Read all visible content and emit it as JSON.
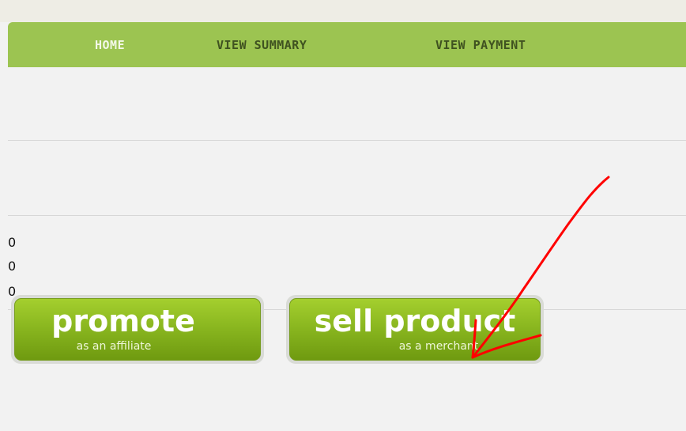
{
  "nav": {
    "home": "HOME",
    "summary": "VIEW SUMMARY",
    "payment": "VIEW PAYMENT"
  },
  "values": [
    "0",
    "0",
    "0"
  ],
  "buttons": {
    "promote": {
      "main": "promote",
      "sub": "as an affiliate"
    },
    "sell": {
      "main": "sell product",
      "sub": "as a merchant"
    }
  },
  "colors": {
    "nav_bg": "#9cc451",
    "button_green": "#85b21d",
    "annotation_red": "#ff0000"
  }
}
